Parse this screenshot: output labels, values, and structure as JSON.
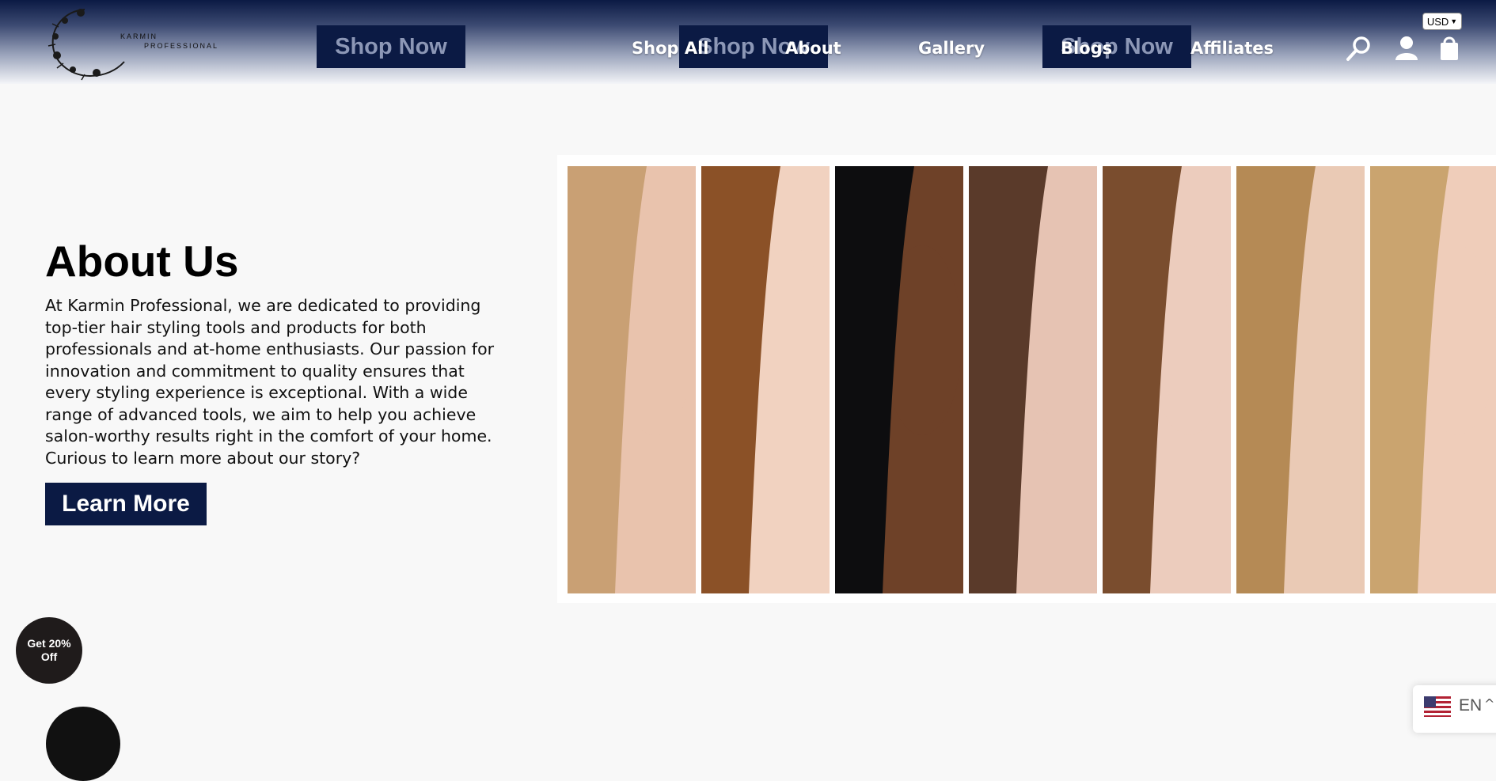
{
  "header": {
    "logo": {
      "icon": "floral-wreath-logo",
      "line1": "KARMIN",
      "line2": "PROFESSIONAL"
    },
    "promo_buttons": [
      "Shop Now",
      "Shop Now",
      "Shop Now"
    ],
    "nav": [
      "Shop All",
      "About",
      "Gallery",
      "Blogs",
      "Affiliates"
    ],
    "currency": "USD",
    "icons": [
      "search-icon",
      "account-icon",
      "cart-icon"
    ]
  },
  "about": {
    "title": "About Us",
    "body": "At Karmin Professional, we are dedicated to providing top-tier hair styling tools and products for both professionals and at-home enthusiasts. Our passion for innovation and commitment to quality ensures that every styling experience is exceptional. With a wide range of advanced tools, we aim to help you achieve salon-worthy results right in the comfort of your home. Curious to learn more about our story?",
    "button": "Learn More"
  },
  "gallery": {
    "strips": [
      {
        "hair": "#c9a074",
        "skin": "#e9c3ad"
      },
      {
        "hair": "#8b5127",
        "skin": "#f1d2c0"
      },
      {
        "hair": "#0d0d0f",
        "skin": "#6e4128"
      },
      {
        "hair": "#5a3a2a",
        "skin": "#e6c3b3"
      },
      {
        "hair": "#7a4d2e",
        "skin": "#ecccbd"
      },
      {
        "hair": "#b58a55",
        "skin": "#eacab5"
      },
      {
        "hair": "#caa46f",
        "skin": "#efcdba"
      }
    ]
  },
  "promo": {
    "label": "Get 20% Off"
  },
  "language": {
    "label": "EN"
  },
  "colors": {
    "brand": "#0b1a44",
    "background": "#f8f8f8"
  }
}
